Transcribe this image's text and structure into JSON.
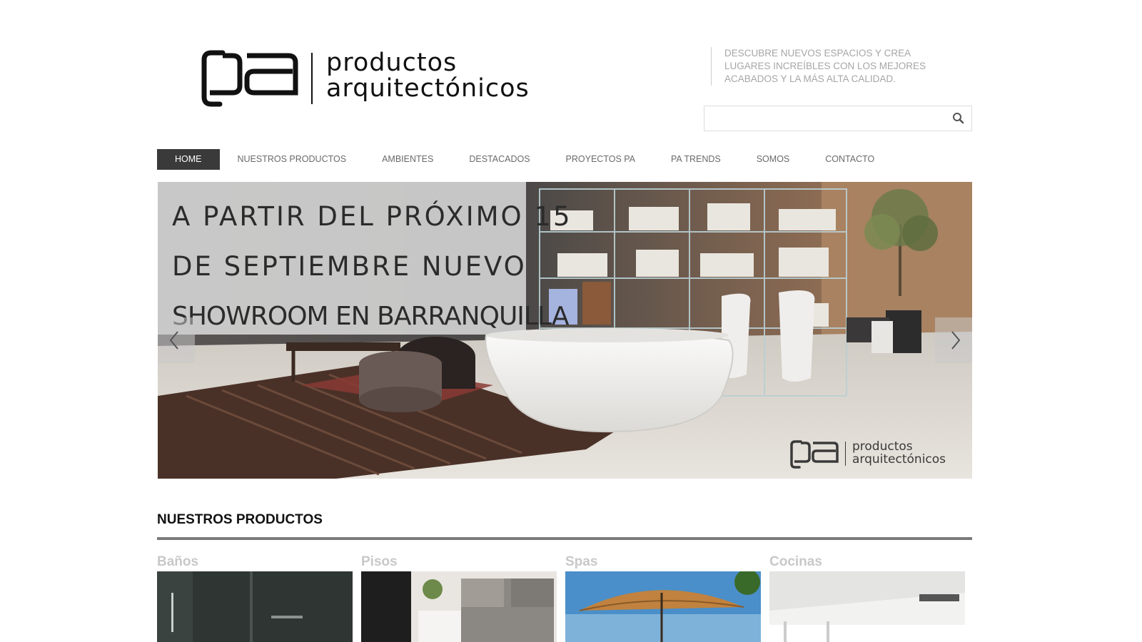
{
  "header": {
    "logo": {
      "line1": "productos",
      "line2": "arquitectónicos"
    },
    "tagline": "DESCUBRE NUEVOS ESPACIOS Y CREA LUGARES INCREÍBLES CON LOS MEJORES ACABADOS Y LA MÁS ALTA CALIDAD.",
    "search": {
      "value": "",
      "placeholder": "",
      "icon": "search-icon"
    }
  },
  "nav": {
    "items": [
      {
        "label": "HOME",
        "active": true
      },
      {
        "label": "NUESTROS PRODUCTOS",
        "active": false
      },
      {
        "label": "AMBIENTES",
        "active": false
      },
      {
        "label": "DESTACADOS",
        "active": false
      },
      {
        "label": "PROYECTOS PA",
        "active": false
      },
      {
        "label": "PA TRENDS",
        "active": false
      },
      {
        "label": "SOMOS",
        "active": false
      },
      {
        "label": "CONTACTO",
        "active": false
      }
    ]
  },
  "hero": {
    "caption": {
      "line1": "A PARTIR DEL PRÓXIMO 15",
      "line2": "DE SEPTIEMBRE NUEVO",
      "line3": "SHOWROOM EN BARRANQUILLA"
    },
    "prev_icon": "chevron-left-icon",
    "next_icon": "chevron-right-icon",
    "watermark": {
      "line1": "productos",
      "line2": "arquitectónicos"
    }
  },
  "products_section": {
    "title": "NUESTROS PRODUCTOS",
    "items": [
      {
        "label": "Baños"
      },
      {
        "label": "Pisos"
      },
      {
        "label": "Spas"
      },
      {
        "label": "Cocinas"
      }
    ]
  },
  "colors": {
    "nav_active_bg": "#3a3a3a",
    "nav_text": "#6a6a6a",
    "tagline_text": "#a6a6a6",
    "product_label": "#c8c8c8",
    "section_rule": "#7a7a7a"
  }
}
